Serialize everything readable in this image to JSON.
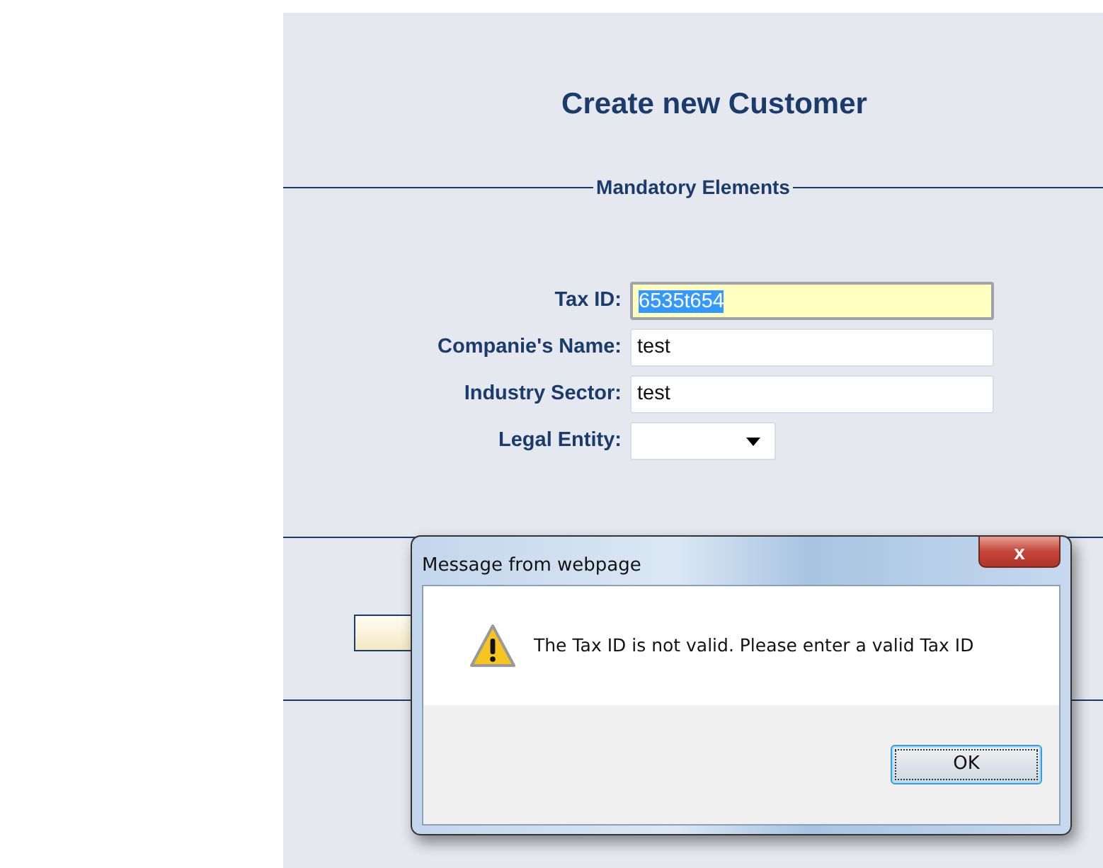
{
  "page": {
    "title": "Create new Customer",
    "section": "Mandatory Elements"
  },
  "fields": [
    {
      "kind": "text",
      "label": "Tax ID:",
      "value": "6535t654",
      "focused": true,
      "highlighted": true
    },
    {
      "kind": "text",
      "label": "Companie's Name:",
      "value": "test",
      "focused": false,
      "highlighted": false
    },
    {
      "kind": "text",
      "label": "Industry Sector:",
      "value": "test",
      "focused": false,
      "highlighted": false
    },
    {
      "kind": "select",
      "label": "Legal Entity:",
      "focused": false
    }
  ],
  "dialog": {
    "title": "Message from webpage",
    "close": "x",
    "message": "The Tax ID is not valid. Please enter a valid Tax ID",
    "buttons": [
      {
        "label": "OK",
        "selected": true
      }
    ]
  }
}
